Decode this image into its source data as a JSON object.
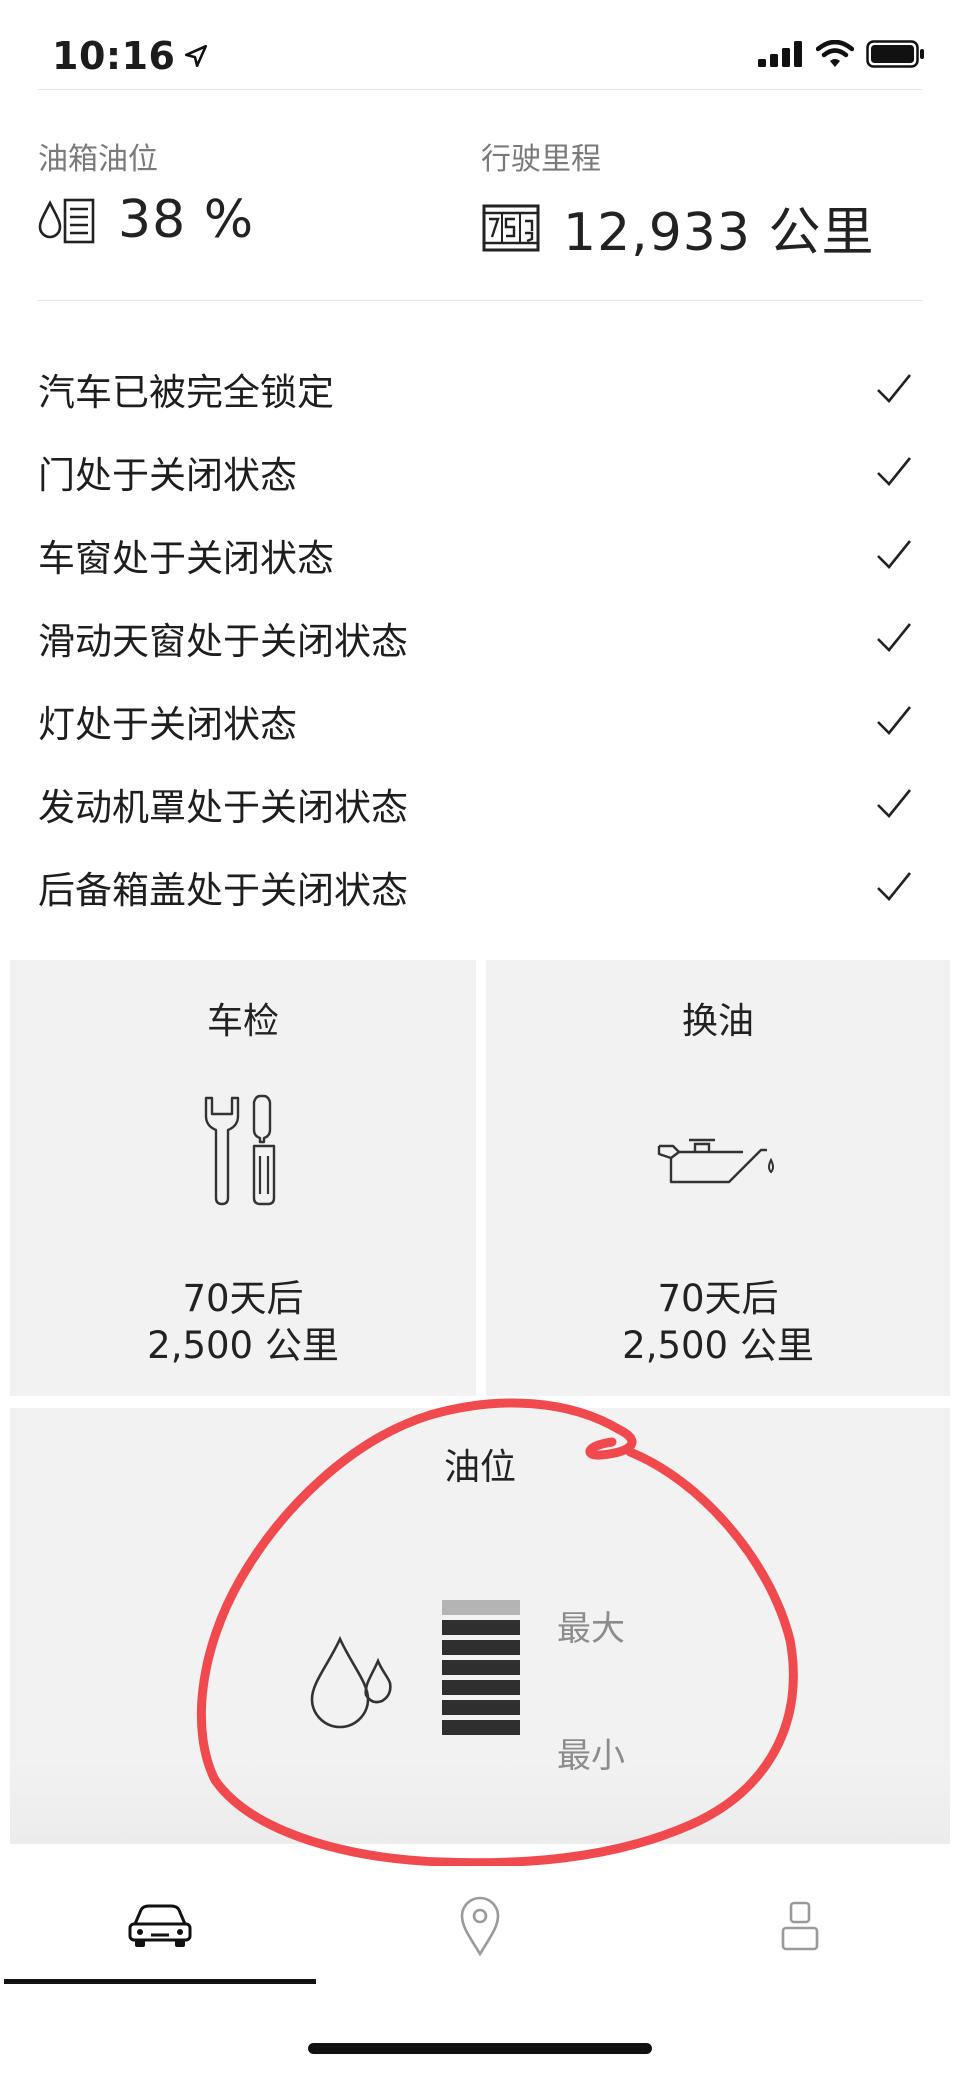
{
  "status_bar": {
    "time": "10:16"
  },
  "summary": {
    "fuel_label": "油箱油位",
    "fuel_value": "38 %",
    "mileage_label": "行驶里程",
    "mileage_value": "12,933 公里"
  },
  "checklist": [
    {
      "label": "汽车已被完全锁定"
    },
    {
      "label": "门处于关闭状态"
    },
    {
      "label": "车窗处于关闭状态"
    },
    {
      "label": "滑动天窗处于关闭状态"
    },
    {
      "label": "灯处于关闭状态"
    },
    {
      "label": "发动机罩处于关闭状态"
    },
    {
      "label": "后备箱盖处于关闭状态"
    }
  ],
  "tiles": {
    "inspection": {
      "title": "车检",
      "days": "70天后",
      "distance": "2,500 公里",
      "icon": "tools-icon"
    },
    "oil_change": {
      "title": "换油",
      "days": "70天后",
      "distance": "2,500 公里",
      "icon": "oil-can-icon"
    },
    "oil_level": {
      "title": "油位",
      "max_label": "最大",
      "min_label": "最小",
      "filled_bars": 6,
      "total_bars": 7,
      "icon": "oil-drops-icon"
    }
  },
  "tab_bar": {
    "tabs": [
      {
        "icon": "car-icon",
        "active": true
      },
      {
        "icon": "location-pin-icon",
        "active": false
      },
      {
        "icon": "profile-icon",
        "active": false
      }
    ]
  },
  "colors": {
    "annotation": "#f04a4e",
    "tile_background": "#f2f2f2",
    "gauge_filled": "#2f2f2f",
    "gauge_empty": "#b4b4b4"
  }
}
